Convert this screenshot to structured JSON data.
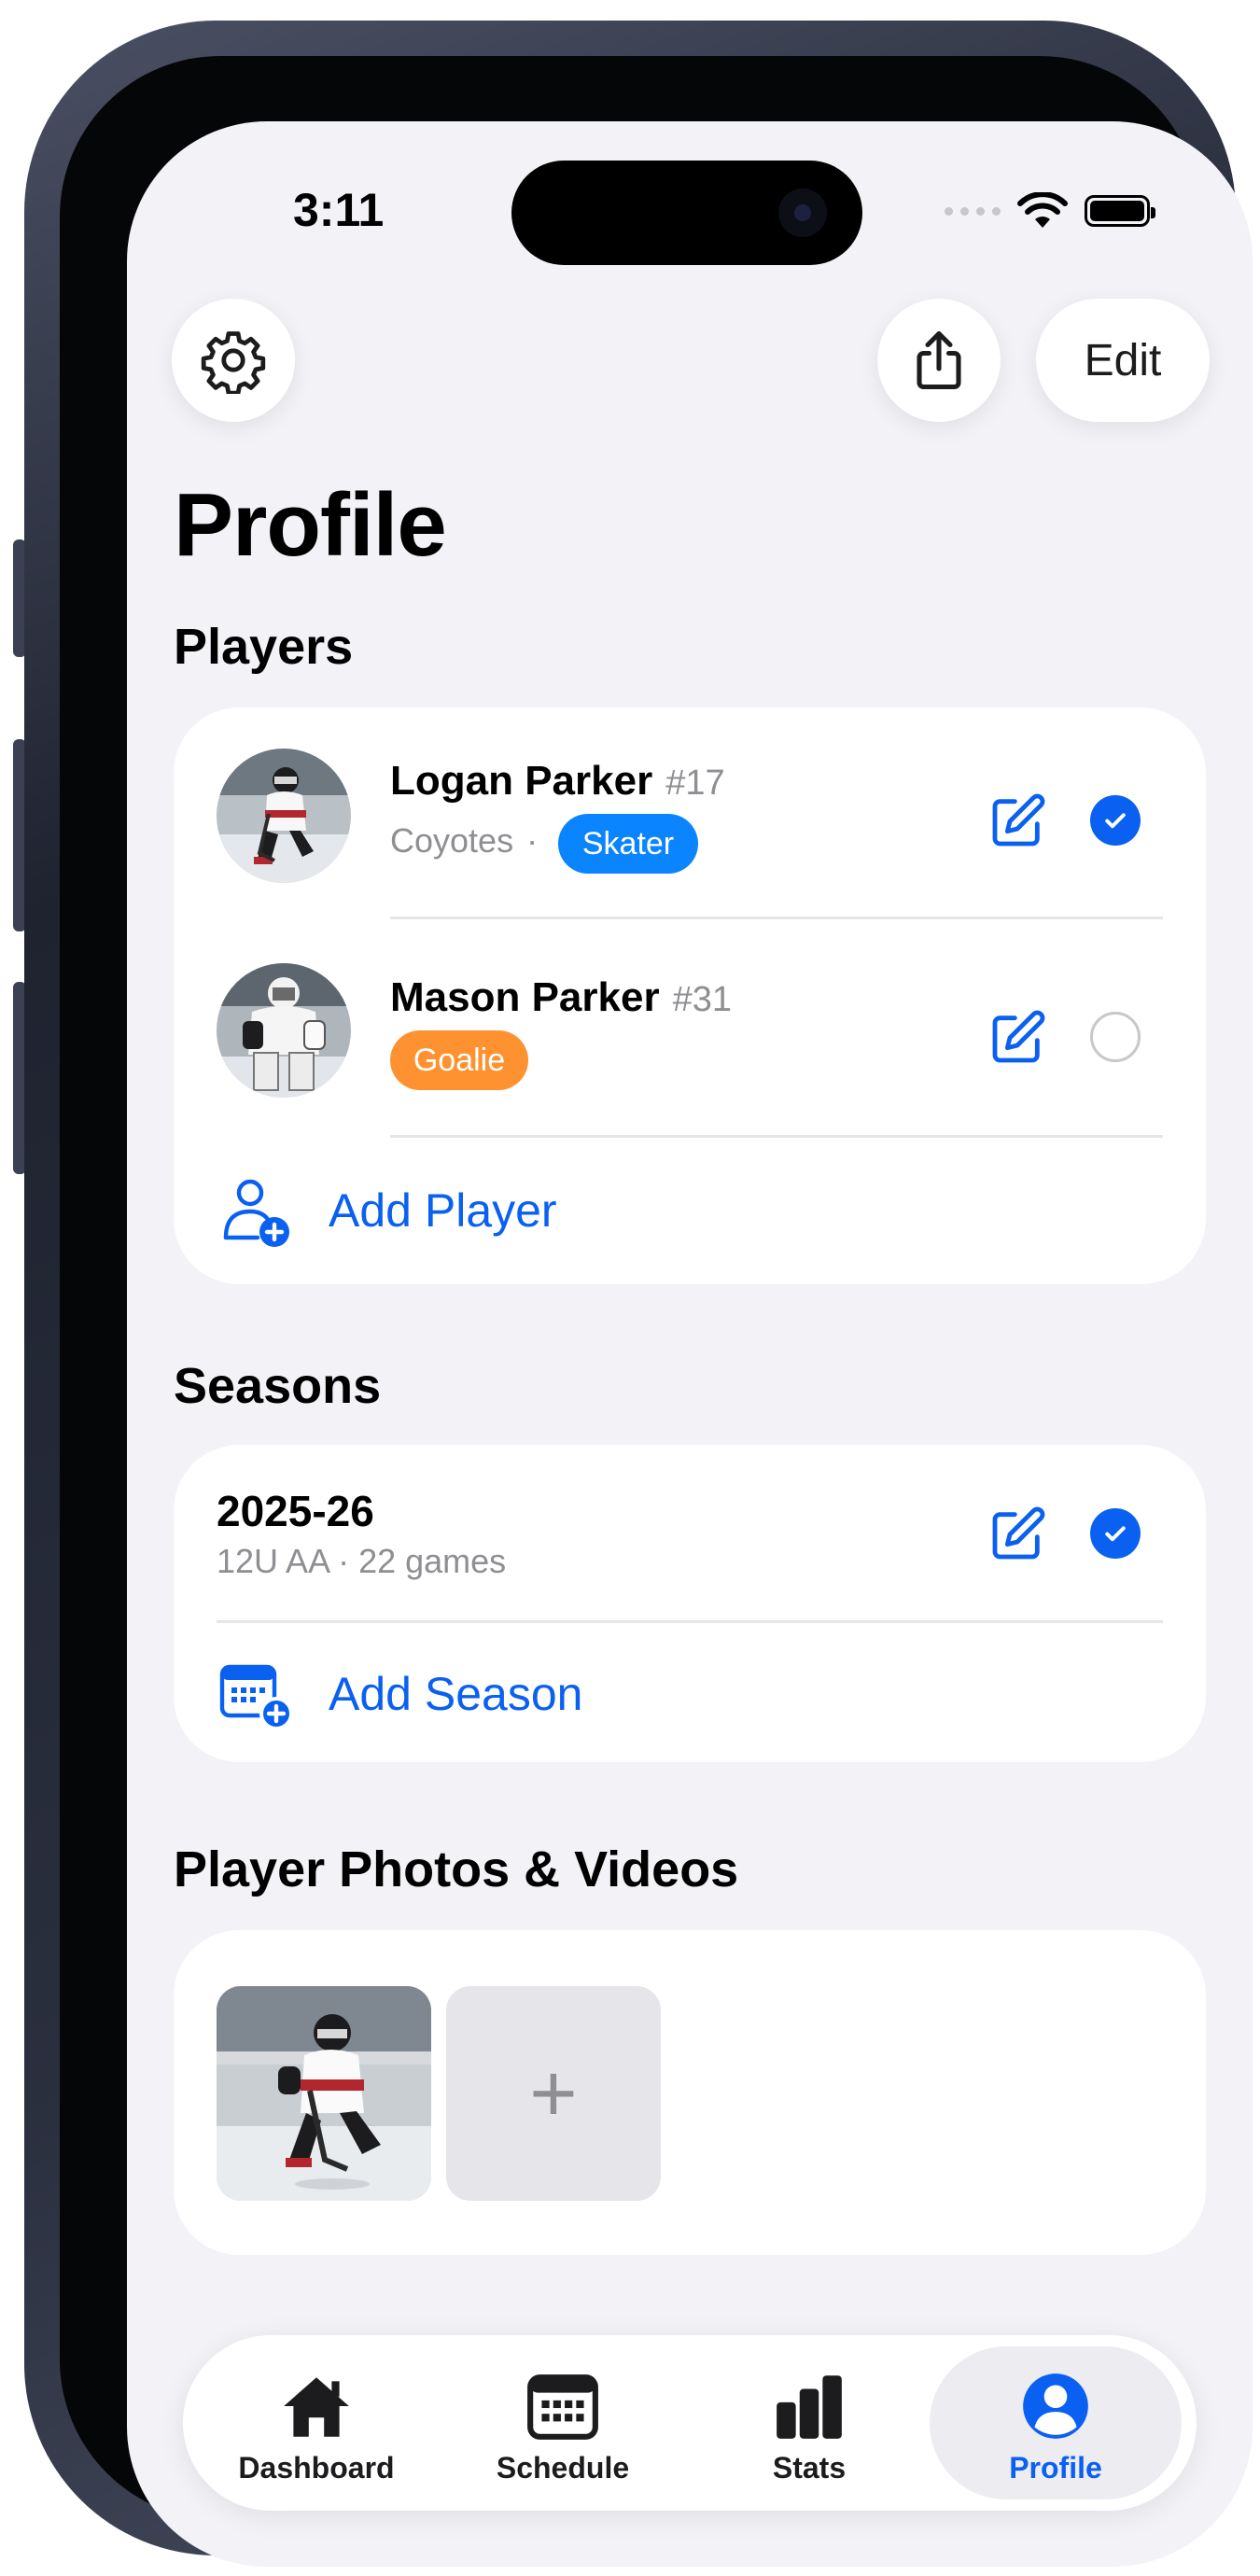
{
  "status_bar": {
    "time": "3:11"
  },
  "header": {
    "edit_label": "Edit",
    "title": "Profile"
  },
  "players_section": {
    "label": "Players",
    "players": [
      {
        "name": "Logan Parker",
        "number": "#17",
        "team": "Coyotes",
        "separator": "·",
        "role": "Skater",
        "role_color": "#0a84ff",
        "selected": true
      },
      {
        "name": "Mason Parker",
        "number": "#31",
        "role": "Goalie",
        "role_color": "#ff9230",
        "selected": false
      }
    ],
    "add_label": "Add Player"
  },
  "seasons_section": {
    "label": "Seasons",
    "seasons": [
      {
        "name": "2025-26",
        "details": "12U AA · 22 games",
        "selected": true
      }
    ],
    "add_label": "Add Season"
  },
  "media_section": {
    "label": "Player Photos & Videos",
    "add_symbol": "+"
  },
  "tab_bar": {
    "tabs": [
      {
        "label": "Dashboard",
        "icon": "house-icon",
        "active": false
      },
      {
        "label": "Schedule",
        "icon": "calendar-icon",
        "active": false
      },
      {
        "label": "Stats",
        "icon": "bar-chart-icon",
        "active": false
      },
      {
        "label": "Profile",
        "icon": "person-circle-icon",
        "active": true
      }
    ]
  },
  "colors": {
    "accent": "#0a60f0",
    "background": "#f2f2f7",
    "skater": "#0a84ff",
    "goalie": "#ff9230"
  }
}
